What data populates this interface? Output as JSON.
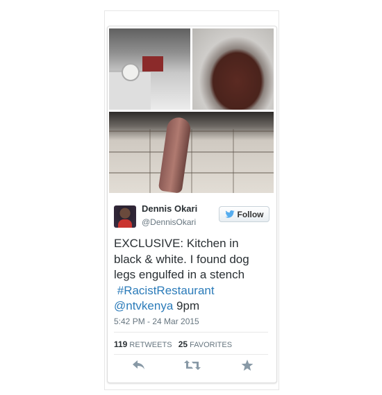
{
  "tweet": {
    "author_name": "Dennis Okari",
    "author_handle": "@DennisOkari",
    "follow_label": "Follow",
    "text_line1": "EXCLUSIVE: Kitchen in",
    "text_line2": "black & white. I found dog",
    "text_line3": "legs engulfed in a stench",
    "hashtag": "#RacistRestaurant",
    "mention": "@ntvkenya",
    "text_tail": " 9pm",
    "timestamp": "5:42 PM - 24 Mar 2015",
    "retweets_count": "119",
    "retweets_label": "RETWEETS",
    "favorites_count": "25",
    "favorites_label": "FAVORITES"
  },
  "icons": {
    "follow": "twitter-bird-icon",
    "reply": "reply-icon",
    "retweet": "retweet-icon",
    "favorite": "star-icon"
  },
  "colors": {
    "link": "#2b7bb9",
    "twitter_blue": "#55acee",
    "muted": "#66757f"
  }
}
